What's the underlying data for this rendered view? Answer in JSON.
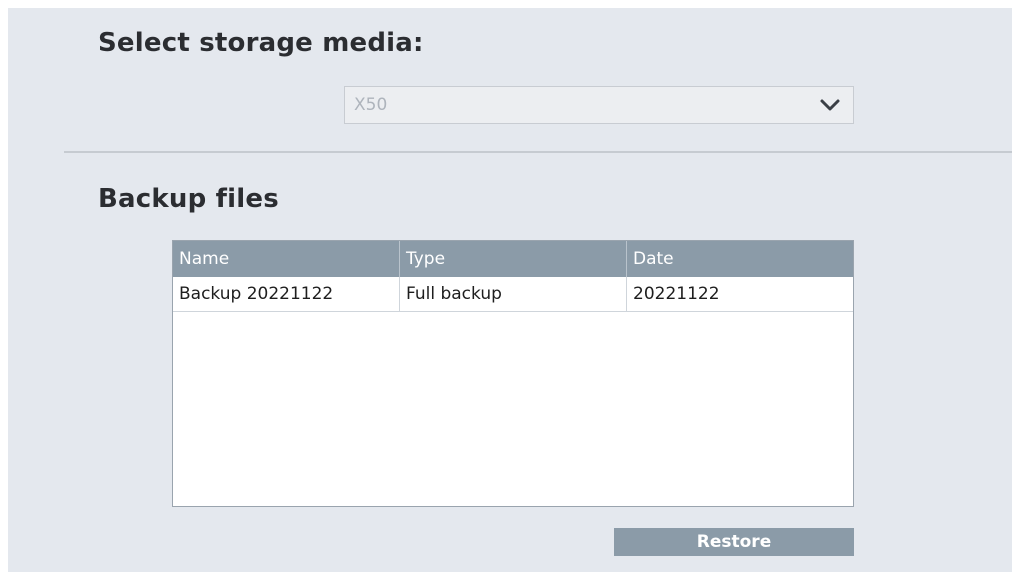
{
  "storage": {
    "heading": "Select storage media:",
    "selected_value": "X50",
    "chevron_icon": "chevron-down-icon"
  },
  "backup": {
    "heading": "Backup files",
    "columns": [
      "Name",
      "Type",
      "Date"
    ],
    "rows": [
      {
        "name": "Backup 20221122",
        "type": "Full backup",
        "date": "20221122"
      }
    ]
  },
  "actions": {
    "restore_label": "Restore"
  },
  "colors": {
    "panel_bg": "#e4e8ee",
    "header_bg": "#8b9ba8",
    "button_bg": "#8b9ba8",
    "disabled_text": "#aeb4bc"
  }
}
